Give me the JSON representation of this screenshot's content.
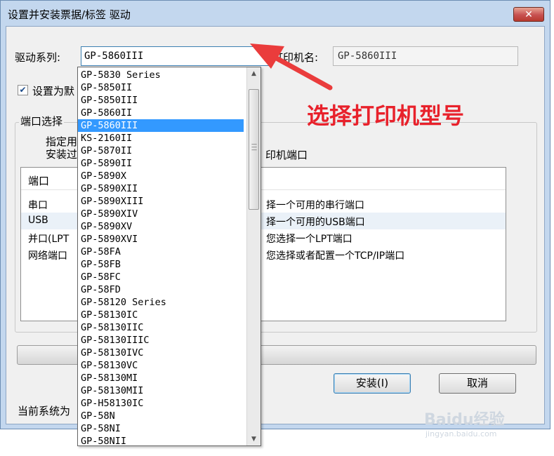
{
  "window": {
    "title": "设置并安装票据/标签 驱动",
    "close": "✕"
  },
  "form": {
    "driver_series_label": "驱动系列:",
    "driver_selected": "GP-5860III",
    "printer_name_label": "打印机名:",
    "printer_name_value": "GP-5860III",
    "default_checkbox_label": "设置为默",
    "default_checked": true,
    "port_group_label": "端口选择",
    "port_hint_line1": "指定用",
    "port_hint_line2": "安装过",
    "port_hint_tail": "印机端口"
  },
  "port_list": {
    "header": "端口",
    "rows": [
      {
        "port": "串口",
        "desc": "择一个可用的串行端口"
      },
      {
        "port": "USB",
        "desc": "择一个可用的USB端口"
      },
      {
        "port": "并口(LPT",
        "desc": "您选择一个LPT端口"
      },
      {
        "port": "网络端口",
        "desc": "您选择或者配置一个TCP/IP端口"
      }
    ]
  },
  "buttons": {
    "install": "安装(I)",
    "cancel": "取消"
  },
  "status_text": "当前系统为",
  "dropdown": {
    "items": [
      "GP-5830 Series",
      "GP-5850II",
      "GP-5850III",
      "GP-5860II",
      "GP-5860III",
      "KS-2160II",
      "GP-5870II",
      "GP-5890II",
      "GP-5890X",
      "GP-5890XII",
      "GP-5890XIII",
      "GP-5890XIV",
      "GP-5890XV",
      "GP-5890XVI",
      "GP-58FA",
      "GP-58FB",
      "GP-58FC",
      "GP-58FD",
      "GP-58120 Series",
      "GP-58130IC",
      "GP-58130IIC",
      "GP-58130IIIC",
      "GP-58130IVC",
      "GP-58130VC",
      "GP-58130MI",
      "GP-58130MII",
      "GP-H58130IC",
      "GP-58N",
      "GP-58NI",
      "GP-58NII"
    ],
    "selected_index": 4
  },
  "annotation": {
    "text": "选择打印机型号",
    "color": "#e8212b"
  },
  "watermark": {
    "brand": "Baidu经验",
    "url": "jingyan.baidu.com"
  }
}
